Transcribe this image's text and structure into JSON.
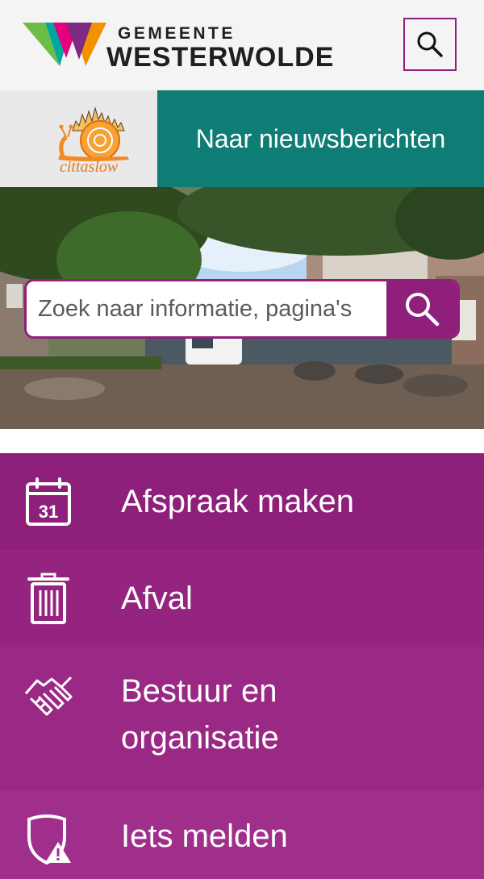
{
  "header": {
    "logo_small": "GEMEENTE",
    "logo_main": "WESTERWOLDE",
    "search_toggle_icon": "search-icon"
  },
  "banner": {
    "cittaslow_text": "cittaslow",
    "news_label": "Naar nieuwsberichten"
  },
  "search": {
    "placeholder": "Zoek naar informatie, pagina's",
    "submit_icon": "search-icon"
  },
  "menu": {
    "items": [
      {
        "label": "Afspraak maken",
        "icon": "calendar-icon",
        "day": "31"
      },
      {
        "label": "Afval",
        "icon": "trash-bin-icon"
      },
      {
        "label": "Bestuur en organisatie",
        "icon": "handshake-icon"
      },
      {
        "label": "Iets melden",
        "icon": "shield-warning-icon"
      }
    ]
  },
  "colors": {
    "brand_purple": "#8f1f7a",
    "teal": "#0e7d75",
    "menu_1": "#8e1f7a",
    "menu_2": "#942480",
    "menu_3": "#9a2985",
    "menu_4": "#a02f8b"
  }
}
